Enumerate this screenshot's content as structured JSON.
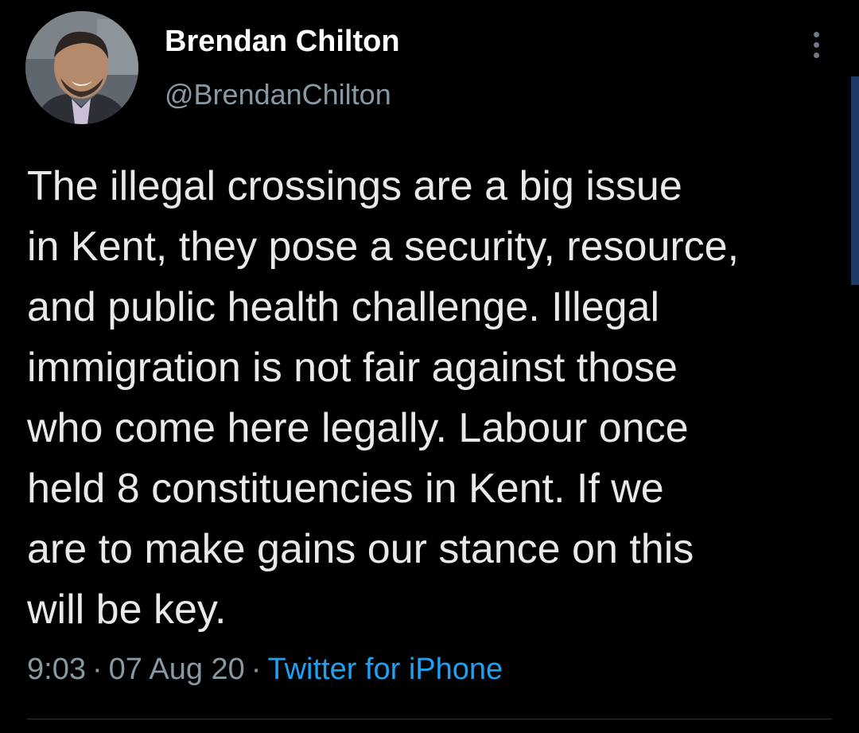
{
  "author": {
    "display_name": "Brendan Chilton",
    "handle": "@BrendanChilton",
    "avatar_icon": "profile-photo"
  },
  "tweet": {
    "text": "The illegal crossings are a big issue\nin Kent, they pose a security, resource,\nand public health challenge. Illegal\nimmigration is not fair against those\nwho come here legally. Labour once\nheld 8 constituencies in Kent. If we\nare to make gains our stance on this\nwill be key."
  },
  "meta": {
    "time": "9:03",
    "separator": "·",
    "date": "07 Aug 20",
    "source": "Twitter for iPhone"
  },
  "actions": {
    "more_icon": "more-vertical-icon"
  },
  "colors": {
    "background": "#000000",
    "text": "#e7e9ea",
    "secondary": "#8899a6",
    "link": "#1da1f2"
  }
}
